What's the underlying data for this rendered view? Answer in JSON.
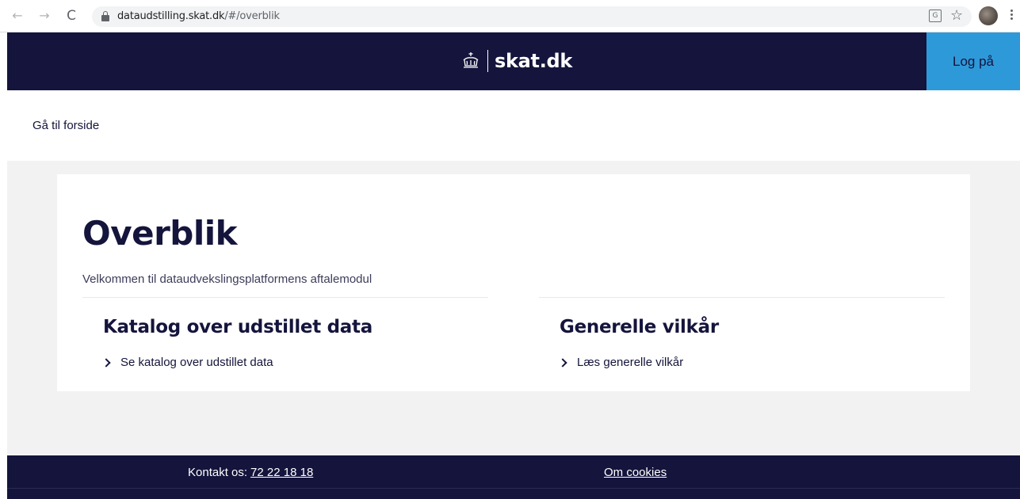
{
  "browser": {
    "url_host": "dataudstilling.skat.dk",
    "url_path": "/#/overblik",
    "back_glyph": "←",
    "forward_glyph": "→",
    "reload_glyph": "C",
    "star_glyph": "☆",
    "translate_glyph": "G"
  },
  "header": {
    "logo_text": "skat.dk",
    "login_label": "Log på",
    "brand_color": "#14143c",
    "accent_color": "#2e99d9"
  },
  "nav": {
    "home_label": "Gå til forside"
  },
  "main": {
    "title": "Overblik",
    "subtitle": "Velkommen til dataudvekslingsplatformens aftalemodul",
    "sections": [
      {
        "heading": "Katalog over udstillet data",
        "link_label": "Se katalog over udstillet data"
      },
      {
        "heading": "Generelle vilkår",
        "link_label": "Læs generelle vilkår"
      }
    ]
  },
  "footer": {
    "contact_label": "Kontakt os:",
    "contact_phone": "72 22 18 18",
    "cookies_label": "Om cookies"
  },
  "icons": [
    "back-arrow-icon",
    "forward-arrow-icon",
    "reload-icon",
    "lock-icon",
    "translate-icon",
    "star-icon",
    "profile-avatar",
    "more-menu-icon",
    "crown-icon",
    "chevron-right-icon"
  ]
}
